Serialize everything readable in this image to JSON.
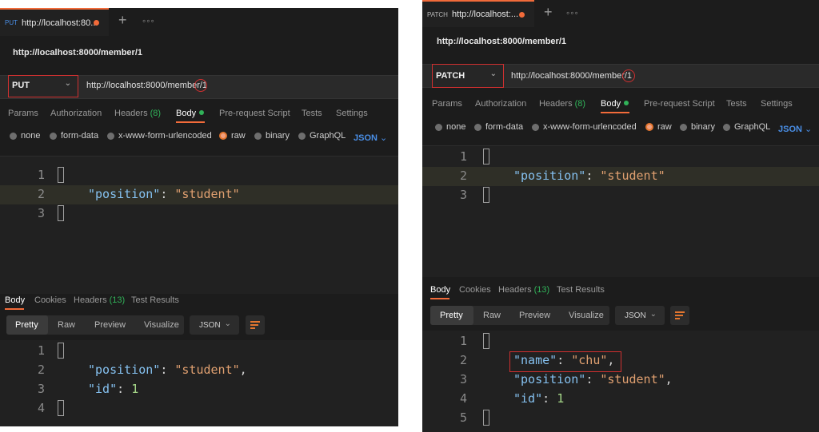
{
  "left": {
    "tab": {
      "method": "PUT",
      "label": "http://localhost:80..."
    },
    "request_title": "http://localhost:8000/member/1",
    "method_select": "PUT",
    "url": "http://localhost:8000/member/1",
    "request_tabs": {
      "params": "Params",
      "authorization": "Authorization",
      "headers": "Headers",
      "headers_count": "(8)",
      "body": "Body",
      "prerequest": "Pre-request Script",
      "tests": "Tests",
      "settings": "Settings"
    },
    "body_types": {
      "none": "none",
      "form_data": "form-data",
      "urlencoded": "x-www-form-urlencoded",
      "raw": "raw",
      "binary": "binary",
      "graphql": "GraphQL",
      "format": "JSON"
    },
    "request_body": {
      "line_numbers": [
        "1",
        "2",
        "3"
      ],
      "key": "\"position\"",
      "colon": ": ",
      "value": "\"student\""
    },
    "response_tabs": {
      "body": "Body",
      "cookies": "Cookies",
      "headers": "Headers",
      "headers_count": "(13)",
      "test_results": "Test Results"
    },
    "view_modes": {
      "pretty": "Pretty",
      "raw": "Raw",
      "preview": "Preview",
      "visualize": "Visualize"
    },
    "format_select": "JSON",
    "response_body": {
      "line_numbers": [
        "1",
        "2",
        "3",
        "4"
      ],
      "k1": "\"position\"",
      "v1": "\"student\"",
      "c1": ",",
      "k2": "\"id\"",
      "v2": "1"
    }
  },
  "right": {
    "tab": {
      "method": "PATCH",
      "label": "http://localhost:..."
    },
    "request_title": "http://localhost:8000/member/1",
    "method_select": "PATCH",
    "url": "http://localhost:8000/member/1",
    "request_tabs": {
      "params": "Params",
      "authorization": "Authorization",
      "headers": "Headers",
      "headers_count": "(8)",
      "body": "Body",
      "prerequest": "Pre-request Script",
      "tests": "Tests",
      "settings": "Settings"
    },
    "body_types": {
      "none": "none",
      "form_data": "form-data",
      "urlencoded": "x-www-form-urlencoded",
      "raw": "raw",
      "binary": "binary",
      "graphql": "GraphQL",
      "format": "JSON"
    },
    "request_body": {
      "line_numbers": [
        "1",
        "2",
        "3"
      ],
      "key": "\"position\"",
      "colon": ": ",
      "value": "\"student\""
    },
    "response_tabs": {
      "body": "Body",
      "cookies": "Cookies",
      "headers": "Headers",
      "headers_count": "(13)",
      "test_results": "Test Results"
    },
    "view_modes": {
      "pretty": "Pretty",
      "raw": "Raw",
      "preview": "Preview",
      "visualize": "Visualize"
    },
    "format_select": "JSON",
    "response_body": {
      "line_numbers": [
        "1",
        "2",
        "3",
        "4",
        "5"
      ],
      "k0": "\"name\"",
      "v0": "\"chu\"",
      "c0": ",",
      "k1": "\"position\"",
      "v1": "\"student\"",
      "c1": ",",
      "k2": "\"id\"",
      "v2": "1"
    }
  },
  "colors": {
    "accent": "#f26b3a",
    "highlight": "#d03030",
    "green": "#31b259",
    "json_key": "#85c1f0",
    "json_string": "#e0a070",
    "json_number": "#a6d889"
  },
  "icons": [
    "plus-icon",
    "more-icon",
    "chevron-down-icon",
    "wrap-icon"
  ]
}
